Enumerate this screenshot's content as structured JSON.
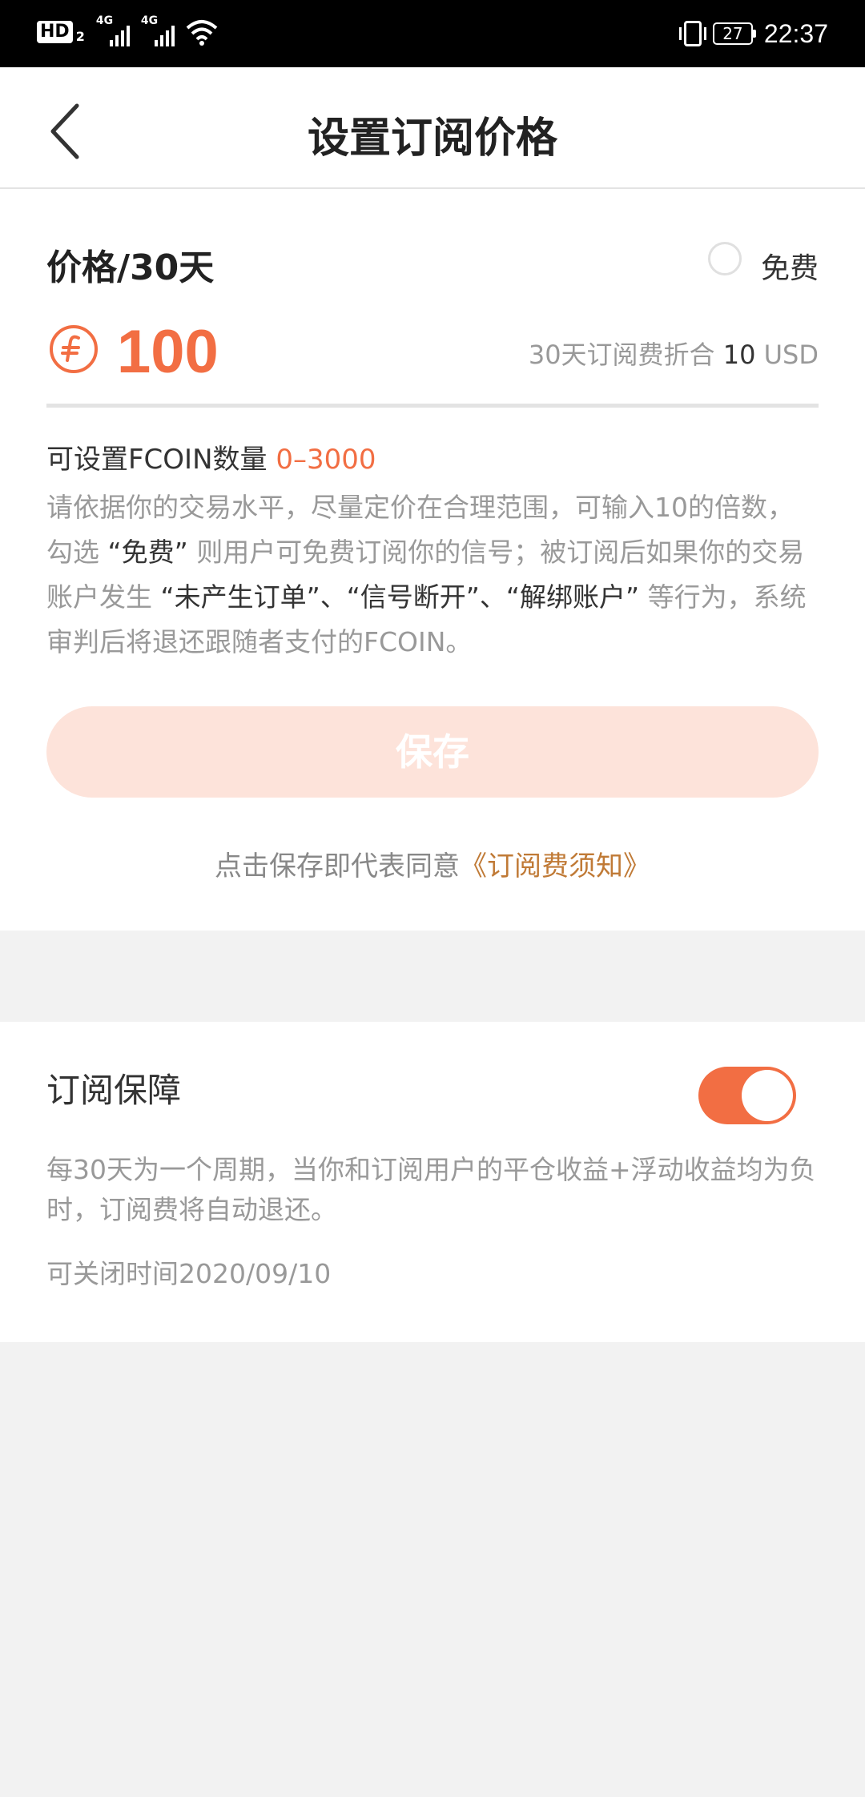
{
  "status_bar": {
    "hd_label": "HD",
    "hd_sub": "2",
    "network_1": "4G",
    "network_2": "4G",
    "battery": "27",
    "time": "22:37"
  },
  "header": {
    "title": "设置订阅价格"
  },
  "price": {
    "label": "价格/30天",
    "free_label": "免费",
    "free_checked": false,
    "value": "100",
    "conversion_prefix": "30天订阅费折合 ",
    "conversion_amount": "10",
    "conversion_unit": " USD",
    "range_prefix": "可设置FCOIN数量 ",
    "range_value": "0–3000",
    "desc_1": "请依据你的交易水平，尽量定价在合理范围，可输入10的倍数，勾选 ",
    "desc_q1": "“免费”",
    "desc_2": " 则用户可免费订阅你的信号；被订阅后如果你的交易账户发生 ",
    "desc_q2": "“未产生订单”、“信号断开”、“解绑账户”",
    "desc_3": " 等行为，系统审判后将退还跟随者支付的FCOIN。",
    "save_label": "保存",
    "agree_prefix": "点击保存即代表同意",
    "agree_link": "《订阅费须知》"
  },
  "guarantee": {
    "title": "订阅保障",
    "enabled": true,
    "description": "每30天为一个周期，当你和订阅用户的平仓收益+浮动收益均为负时，订阅费将自动退还。",
    "closable_time": "可关闭时间2020/09/10"
  },
  "colors": {
    "accent": "#f26e43",
    "save_disabled": "#fde3da",
    "link": "#c07a36"
  }
}
